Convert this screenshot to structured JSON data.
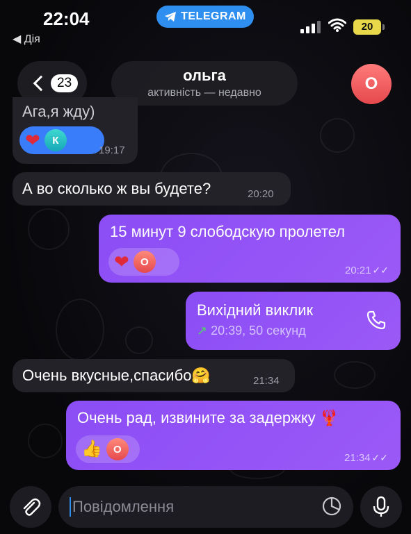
{
  "status_bar": {
    "time": "22:04",
    "back_app": "◀ Дія",
    "telegram_label": "TELEGRAM",
    "battery": "20"
  },
  "header": {
    "unread_count": "23",
    "contact_name": "ольга",
    "contact_status": "активність — недавно",
    "avatar_letter": "О"
  },
  "messages": [
    {
      "direction": "in",
      "text": "Ага,я жду)",
      "time": "19:17",
      "reactions": [
        "heart",
        "К"
      ]
    },
    {
      "direction": "in",
      "text": "А во сколько ж вы будете?",
      "time": "20:20"
    },
    {
      "direction": "out",
      "text": "15 минут 9 слободскую пролетел",
      "time": "20:21",
      "reactions": [
        "heart",
        "О"
      ]
    },
    {
      "direction": "out",
      "type": "call",
      "title": "Вихідний виклик",
      "detail": "20:39, 50 секунд"
    },
    {
      "direction": "in",
      "text": "Очень вкусные,спасибо🤗",
      "time": "21:34"
    },
    {
      "direction": "out",
      "text": "Очень рад, извините за задержку 🦞",
      "time": "21:34",
      "reactions": [
        "thumbs-up",
        "О"
      ]
    }
  ],
  "input": {
    "placeholder": "Повідомлення"
  },
  "colors": {
    "outgoing_bubble": "#8b4df5",
    "incoming_bubble": "#232228",
    "accent": "#2f8ff0"
  },
  "icons": [
    "telegram-icon",
    "signal-icon",
    "wifi-icon",
    "battery-icon",
    "chevron-left-icon",
    "heart-icon",
    "thumbs-up-icon",
    "read-ticks-icon",
    "phone-icon",
    "outgoing-call-arrow-icon",
    "attach-icon",
    "sticker-icon",
    "microphone-icon"
  ]
}
